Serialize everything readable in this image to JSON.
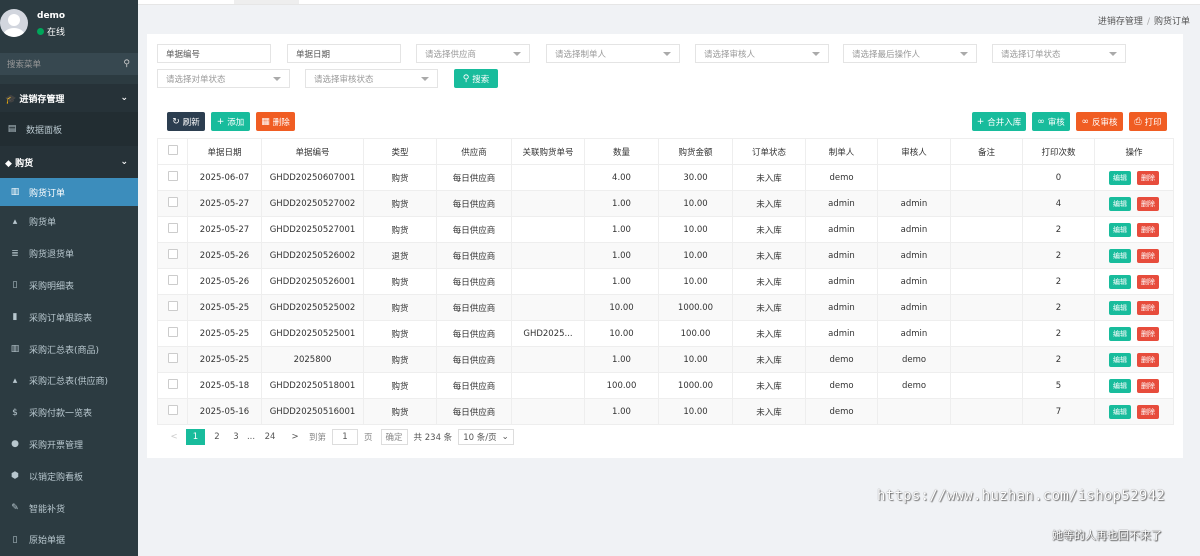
{
  "user": {
    "name": "demo",
    "status": "在线"
  },
  "sidebar": {
    "search_placeholder": "搜索菜单",
    "group1": "进销存管理",
    "dashboard": "数据面板",
    "group2": "购货",
    "items": [
      "购货订单",
      "购货单",
      "购货退货单",
      "采购明细表",
      "采购订单跟踪表",
      "采购汇总表(商品)",
      "采购汇总表(供应商)",
      "采购付款一览表",
      "采购开票管理",
      "以销定购看板",
      "智能补货",
      "原始单据"
    ]
  },
  "breadcrumb": {
    "parent": "进销存管理",
    "current": "购货订单"
  },
  "filters": {
    "doc_no": "单据编号",
    "doc_date": "单据日期",
    "supplier": "请选择供应商",
    "maker": "请选择制单人",
    "auditor": "请选择审核人",
    "last_op": "请选择最后操作人",
    "order_status": "请选择订单状态",
    "recon_status": "请选择对单状态",
    "audit_status": "请选择审核状态",
    "search_btn": "搜索"
  },
  "toolbar": {
    "refresh": "刷新",
    "add": "添加",
    "delete": "删除",
    "merge": "合并入库",
    "audit": "审核",
    "unaudit": "反审核",
    "print": "打印"
  },
  "table": {
    "headers": [
      "单据日期",
      "单据编号",
      "类型",
      "供应商",
      "关联购货单号",
      "数量",
      "购货金额",
      "订单状态",
      "制单人",
      "审核人",
      "备注",
      "打印次数",
      "操作"
    ],
    "rows": [
      [
        "2025-06-07",
        "GHDD20250607001",
        "购货",
        "每日供应商",
        "",
        "4.00",
        "30.00",
        "未入库",
        "demo",
        "",
        "",
        "0"
      ],
      [
        "2025-05-27",
        "GHDD20250527002",
        "购货",
        "每日供应商",
        "",
        "1.00",
        "10.00",
        "未入库",
        "admin",
        "admin",
        "",
        "4"
      ],
      [
        "2025-05-27",
        "GHDD20250527001",
        "购货",
        "每日供应商",
        "",
        "1.00",
        "10.00",
        "未入库",
        "admin",
        "admin",
        "",
        "2"
      ],
      [
        "2025-05-26",
        "GHDD20250526002",
        "退货",
        "每日供应商",
        "",
        "1.00",
        "10.00",
        "未入库",
        "admin",
        "admin",
        "",
        "2"
      ],
      [
        "2025-05-26",
        "GHDD20250526001",
        "购货",
        "每日供应商",
        "",
        "1.00",
        "10.00",
        "未入库",
        "admin",
        "admin",
        "",
        "2"
      ],
      [
        "2025-05-25",
        "GHDD20250525002",
        "购货",
        "每日供应商",
        "",
        "10.00",
        "1000.00",
        "未入库",
        "admin",
        "admin",
        "",
        "2"
      ],
      [
        "2025-05-25",
        "GHDD20250525001",
        "购货",
        "每日供应商",
        "GHD2025...",
        "10.00",
        "100.00",
        "未入库",
        "admin",
        "admin",
        "",
        "2"
      ],
      [
        "2025-05-25",
        "2025800",
        "购货",
        "每日供应商",
        "",
        "1.00",
        "10.00",
        "未入库",
        "demo",
        "demo",
        "",
        "2"
      ],
      [
        "2025-05-18",
        "GHDD20250518001",
        "购货",
        "每日供应商",
        "",
        "100.00",
        "1000.00",
        "未入库",
        "demo",
        "demo",
        "",
        "5"
      ],
      [
        "2025-05-16",
        "GHDD20250516001",
        "购货",
        "每日供应商",
        "",
        "1.00",
        "10.00",
        "未入库",
        "demo",
        "",
        "",
        "7"
      ]
    ],
    "edit_label": "编辑",
    "delete_label": "删除"
  },
  "pager": {
    "pages": [
      "1",
      "2",
      "3"
    ],
    "ellipsis": "...",
    "last": "24",
    "goto": "到第",
    "page_input": "1",
    "page_unit": "页",
    "confirm": "确定",
    "total": "共 234 条",
    "per_page": "10 条/页"
  },
  "watermark": {
    "line1": "https://www.huzhan.com/ishop52942",
    "line2": "她等的人再也回不来了"
  },
  "colors": {
    "sidebar": "#2c3b41",
    "active": "#3c8dbc",
    "teal": "#18bc9c",
    "red": "#e74c3c",
    "orange": "#f05d23",
    "dark": "#2c3e50"
  }
}
